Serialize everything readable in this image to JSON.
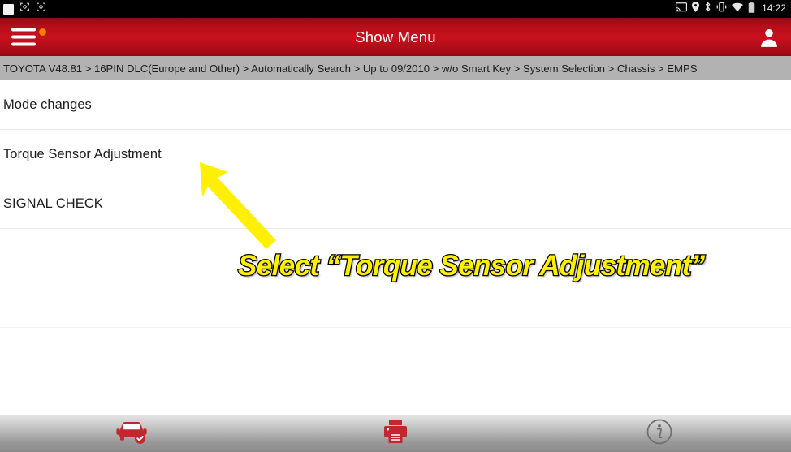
{
  "statusbar": {
    "left_icons": [
      "white-square-icon",
      "screenshot-capture-icon",
      "screenshot-capture-icon"
    ],
    "right_icons": [
      "cast-screen-icon",
      "location-pin-icon",
      "bluetooth-icon",
      "vibrate-icon",
      "wifi-icon",
      "battery-icon"
    ],
    "time": "14:22"
  },
  "header": {
    "menu_icon": "hamburger-menu-icon",
    "badge_color": "#f08000",
    "title": "Show Menu",
    "user_icon": "user-account-icon",
    "background_color": "#c8111d"
  },
  "breadcrumb": {
    "text": "TOYOTA V48.81 > 16PIN DLC(Europe and Other) > Automatically Search > Up to 09/2010 > w/o Smart Key > System Selection > Chassis > EMPS",
    "segments": [
      "TOYOTA V48.81",
      "16PIN DLC(Europe and Other)",
      "Automatically Search",
      "Up to 09/2010",
      "w/o Smart Key",
      "System Selection",
      "Chassis",
      "EMPS"
    ],
    "background_color": "#b2b2b2"
  },
  "menu": {
    "items": [
      {
        "label": "Mode changes"
      },
      {
        "label": "Torque Sensor Adjustment"
      },
      {
        "label": "SIGNAL CHECK"
      }
    ]
  },
  "annotation": {
    "text": "Select “Torque Sensor Adjustment”",
    "fill_color": "#ffef00",
    "outline_color": "#000000",
    "arrow": "yellow-arrow-pointing-up-left",
    "arrow_color": "#ffef00"
  },
  "bottombar": {
    "items": [
      {
        "icon": "vehicle-check-icon",
        "color": "#c1272d"
      },
      {
        "icon": "printer-icon",
        "color": "#c1272d"
      },
      {
        "icon": "info-icon",
        "color": "#6e6e6e"
      }
    ]
  }
}
